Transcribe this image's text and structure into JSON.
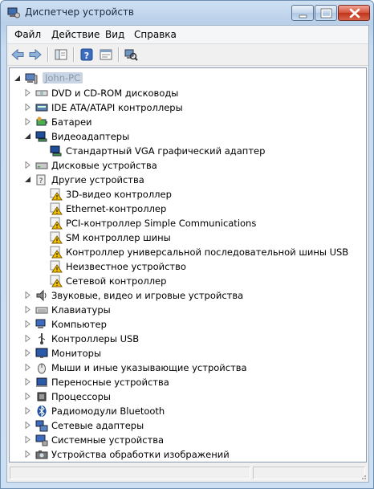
{
  "window": {
    "title": "Диспетчер устройств"
  },
  "menu": [
    "Файл",
    "Действие",
    "Вид",
    "Справка"
  ],
  "tree": {
    "host": "John-PC",
    "items": [
      {
        "label": "DVD и CD-ROM дисководы",
        "icon": "dvd-drive-icon",
        "level": 1,
        "expander": "collapsed"
      },
      {
        "label": "IDE ATA/ATAPI контроллеры",
        "icon": "ide-controller-icon",
        "level": 1,
        "expander": "collapsed"
      },
      {
        "label": "Батареи",
        "icon": "battery-icon",
        "level": 1,
        "expander": "collapsed"
      },
      {
        "label": "Видеоадаптеры",
        "icon": "display-adapter-icon",
        "level": 1,
        "expander": "expanded"
      },
      {
        "label": "Стандартный VGA графический адаптер",
        "icon": "display-adapter-icon",
        "level": 2,
        "expander": "none"
      },
      {
        "label": "Дисковые устройства",
        "icon": "disk-drive-icon",
        "level": 1,
        "expander": "collapsed"
      },
      {
        "label": "Другие устройства",
        "icon": "unknown-device-icon",
        "level": 1,
        "expander": "expanded"
      },
      {
        "label": "3D-видео контроллер",
        "icon": "warning-device-icon",
        "level": 2,
        "expander": "none"
      },
      {
        "label": "Ethernet-контроллер",
        "icon": "warning-device-icon",
        "level": 2,
        "expander": "none"
      },
      {
        "label": "PCI-контроллер Simple Communications",
        "icon": "warning-device-icon",
        "level": 2,
        "expander": "none"
      },
      {
        "label": "SM контроллер шины",
        "icon": "warning-device-icon",
        "level": 2,
        "expander": "none"
      },
      {
        "label": "Контроллер универсальной последовательной шины USB",
        "icon": "warning-device-icon",
        "level": 2,
        "expander": "none"
      },
      {
        "label": "Неизвестное устройство",
        "icon": "warning-device-icon",
        "level": 2,
        "expander": "none"
      },
      {
        "label": "Сетевой контроллер",
        "icon": "warning-device-icon",
        "level": 2,
        "expander": "none"
      },
      {
        "label": "Звуковые, видео и игровые устройства",
        "icon": "sound-icon",
        "level": 1,
        "expander": "collapsed"
      },
      {
        "label": "Клавиатуры",
        "icon": "keyboard-icon",
        "level": 1,
        "expander": "collapsed"
      },
      {
        "label": "Компьютер",
        "icon": "computer-icon",
        "level": 1,
        "expander": "collapsed"
      },
      {
        "label": "Контроллеры USB",
        "icon": "usb-icon",
        "level": 1,
        "expander": "collapsed"
      },
      {
        "label": "Мониторы",
        "icon": "monitor-icon",
        "level": 1,
        "expander": "collapsed"
      },
      {
        "label": "Мыши и иные указывающие устройства",
        "icon": "mouse-icon",
        "level": 1,
        "expander": "collapsed"
      },
      {
        "label": "Переносные устройства",
        "icon": "portable-device-icon",
        "level": 1,
        "expander": "collapsed"
      },
      {
        "label": "Процессоры",
        "icon": "processor-icon",
        "level": 1,
        "expander": "collapsed"
      },
      {
        "label": "Радиомодули Bluetooth",
        "icon": "bluetooth-icon",
        "level": 1,
        "expander": "collapsed"
      },
      {
        "label": "Сетевые адаптеры",
        "icon": "network-adapter-icon",
        "level": 1,
        "expander": "collapsed"
      },
      {
        "label": "Системные устройства",
        "icon": "system-device-icon",
        "level": 1,
        "expander": "collapsed"
      },
      {
        "label": "Устройства обработки изображений",
        "icon": "imaging-device-icon",
        "level": 1,
        "expander": "collapsed"
      }
    ]
  },
  "colors": {
    "accent": "#3a6ea5",
    "warning": "#f2c200",
    "close_button": "#c8402a"
  }
}
